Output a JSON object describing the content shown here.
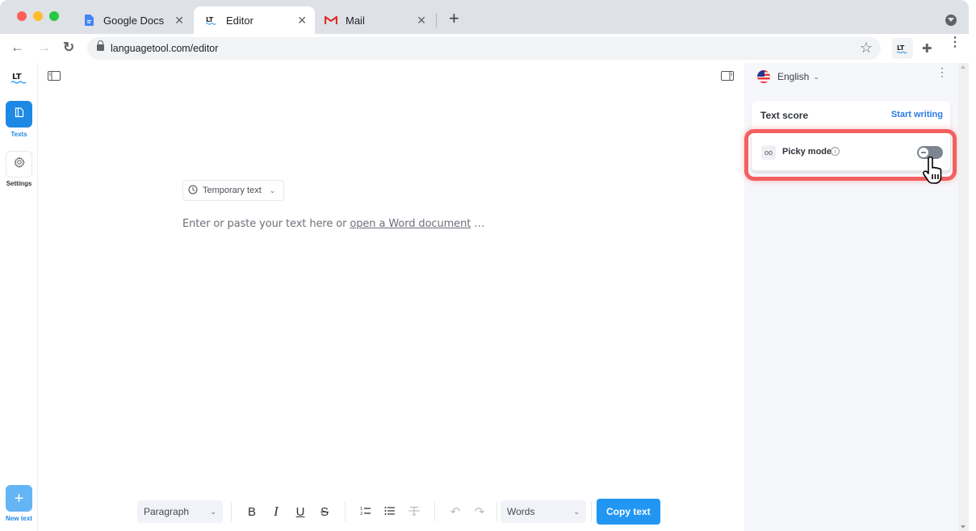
{
  "browser": {
    "tabs": [
      {
        "title": "Google Docs",
        "icon": "google-docs-icon",
        "active": false
      },
      {
        "title": "Editor",
        "icon": "languagetool-icon",
        "active": true
      },
      {
        "title": "Mail",
        "icon": "gmail-icon",
        "active": false
      }
    ],
    "close_glyph": "✕",
    "new_tab_glyph": "+",
    "url": "languagetool.com/editor",
    "nav": {
      "back": "←",
      "forward": "→",
      "reload": "↻"
    },
    "star_glyph": "☆",
    "extension_label": "LT",
    "puzzle_glyph": "✚",
    "menu_glyph": "⋮"
  },
  "leftnav": {
    "logo": "LT",
    "items": [
      {
        "label": "Texts",
        "icon": "document-icon",
        "active": true
      },
      {
        "label": "Settings",
        "icon": "gear-icon",
        "active": false
      }
    ],
    "new_text": {
      "label": "New text",
      "glyph": "+"
    }
  },
  "editor": {
    "temp_button": "Temporary text",
    "placeholder_prefix": "Enter or paste your text here or ",
    "placeholder_link": "open a Word document",
    "placeholder_suffix": " …",
    "toolbar": {
      "paragraph_select": "Paragraph",
      "bold": "B",
      "italic": "I",
      "underline": "U",
      "strike": "S",
      "ordered_list": "1≡",
      "bullet_list": "☰",
      "clear_format": "T̶",
      "undo": "↶",
      "redo": "↷",
      "count_select": "Words",
      "copy_button": "Copy text"
    }
  },
  "rightpanel": {
    "language": "English",
    "text_score_label": "Text score",
    "start_writing_link": "Start writing",
    "picky_mode_label": "Picky mode",
    "picky_mode_enabled": false,
    "info_glyph": "i",
    "glasses_glyph": "oo"
  },
  "colors": {
    "accent": "#2196f3",
    "highlight": "#f26060",
    "link": "#2a7be4"
  }
}
